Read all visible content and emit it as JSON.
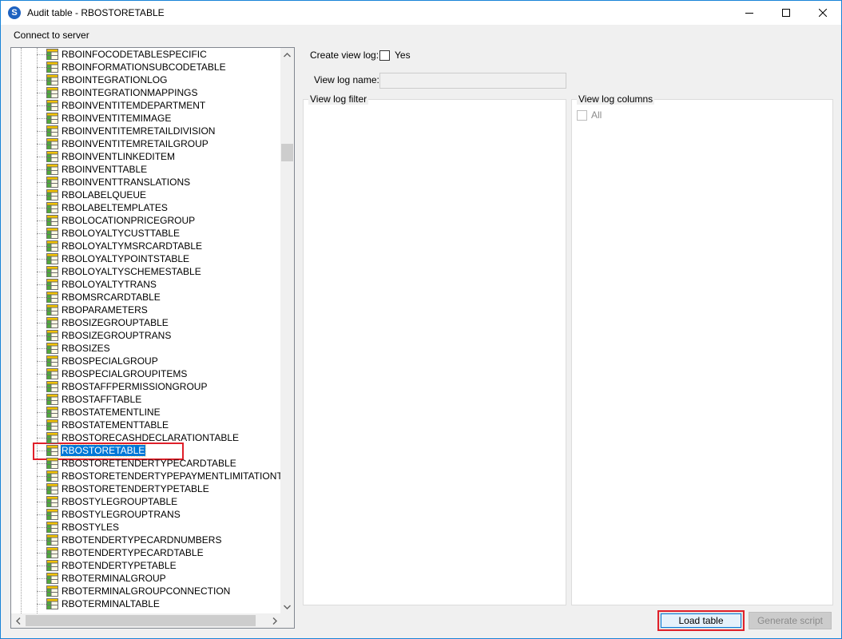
{
  "window": {
    "title": "Audit table - RBOSTORETABLE",
    "app_icon_glyph": "S",
    "icons": {
      "minimize": "minimize-icon",
      "maximize": "maximize-icon",
      "close": "close-icon"
    }
  },
  "menu": {
    "connect": "Connect to server"
  },
  "tree": {
    "items": [
      "RBOINFOCODETABLESPECIFIC",
      "RBOINFORMATIONSUBCODETABLE",
      "RBOINTEGRATIONLOG",
      "RBOINTEGRATIONMAPPINGS",
      "RBOINVENTITEMDEPARTMENT",
      "RBOINVENTITEMIMAGE",
      "RBOINVENTITEMRETAILDIVISION",
      "RBOINVENTITEMRETAILGROUP",
      "RBOINVENTLINKEDITEM",
      "RBOINVENTTABLE",
      "RBOINVENTTRANSLATIONS",
      "RBOLABELQUEUE",
      "RBOLABELTEMPLATES",
      "RBOLOCATIONPRICEGROUP",
      "RBOLOYALTYCUSTTABLE",
      "RBOLOYALTYMSRCARDTABLE",
      "RBOLOYALTYPOINTSTABLE",
      "RBOLOYALTYSCHEMESTABLE",
      "RBOLOYALTYTRANS",
      "RBOMSRCARDTABLE",
      "RBOPARAMETERS",
      "RBOSIZEGROUPTABLE",
      "RBOSIZEGROUPTRANS",
      "RBOSIZES",
      "RBOSPECIALGROUP",
      "RBOSPECIALGROUPITEMS",
      "RBOSTAFFPERMISSIONGROUP",
      "RBOSTAFFTABLE",
      "RBOSTATEMENTLINE",
      "RBOSTATEMENTTABLE",
      "RBOSTORECASHDECLARATIONTABLE",
      "RBOSTORETABLE",
      "RBOSTORETENDERTYPECARDTABLE",
      "RBOSTORETENDERTYPEPAYMENTLIMITATIONTABL",
      "RBOSTORETENDERTYPETABLE",
      "RBOSTYLEGROUPTABLE",
      "RBOSTYLEGROUPTRANS",
      "RBOSTYLES",
      "RBOTENDERTYPECARDNUMBERS",
      "RBOTENDERTYPECARDTABLE",
      "RBOTENDERTYPETABLE",
      "RBOTERMINALGROUP",
      "RBOTERMINALGROUPCONNECTION",
      "RBOTERMINALTABLE"
    ],
    "selected_index": 31
  },
  "form": {
    "create_view_log_label": "Create view log:",
    "create_view_log_yes": "Yes",
    "view_log_name_label": "View log name:",
    "view_log_name_value": "",
    "view_log_filter_title": "View log filter",
    "view_log_columns_title": "View log columns",
    "all_label": "All"
  },
  "buttons": {
    "load_table": "Load table",
    "generate_script": "Generate script"
  },
  "colors": {
    "selection": "#0078d7",
    "highlight_border": "#e0202a",
    "window_border": "#1883d7"
  }
}
